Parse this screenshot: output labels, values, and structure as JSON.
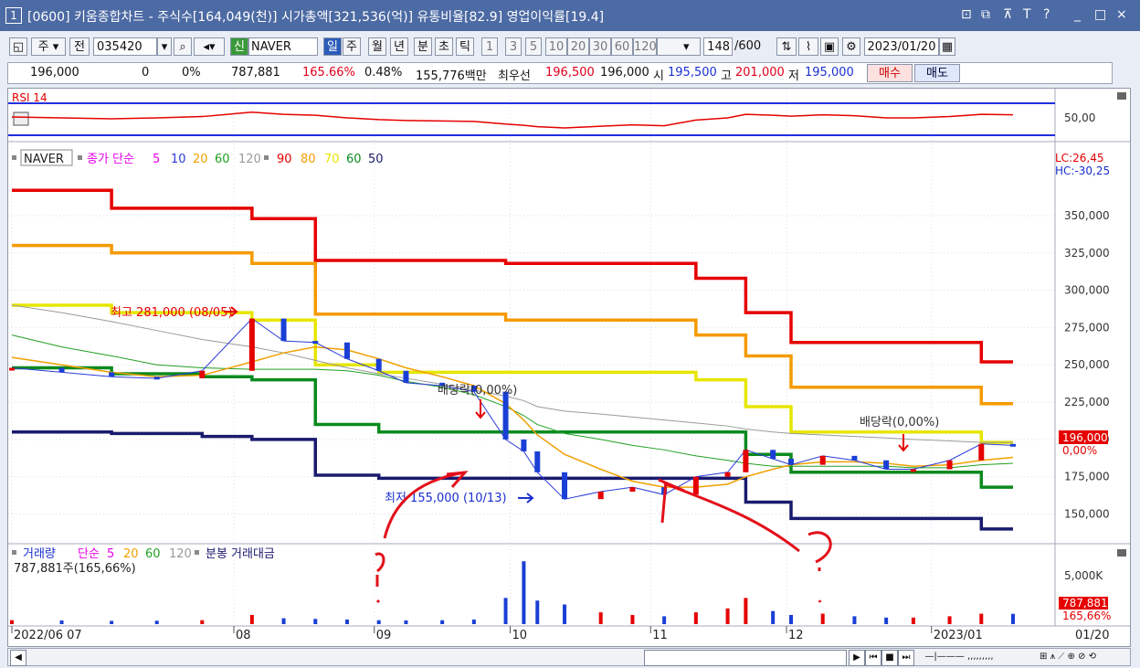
{
  "window": {
    "number": "1",
    "title": "[0600] 키움종합차트 - 주식수[164,049(천)] 시가총액[321,536(억)] 유통비율[82.9] 영업이익률[19.4]",
    "controls": [
      "⊡",
      "⧉",
      "ㄹ",
      "T",
      "?",
      "|",
      "_",
      "□",
      "×"
    ]
  },
  "toolbar": {
    "tab_week": "주",
    "tab_prev": "전",
    "code": "035420",
    "new_label": "신",
    "stock_name": "NAVER",
    "periods": [
      "일",
      "주",
      "월",
      "년",
      "분",
      "초",
      "틱"
    ],
    "minutes": [
      "1",
      "3",
      "5",
      "10",
      "20",
      "30",
      "60",
      "120"
    ],
    "count": "148",
    "count_total": "/600",
    "date": "2023/01/20"
  },
  "quote": {
    "price": "196,000",
    "change": "0",
    "change_pct": "0%",
    "volume": "787,881",
    "volume_ratio": "165.66%",
    "turnover": "0.48%",
    "amount": "155,776백만",
    "best_label": "최우선",
    "best_ask": "196,500",
    "best_bid": "196,000",
    "open_label": "시",
    "open": "195,500",
    "high_label": "고",
    "high": "201,000",
    "low_label": "저",
    "low": "195,000",
    "buy": "매수",
    "sell": "매도"
  },
  "rsi_panel": {
    "label": "RSI 14",
    "tick": "50,00"
  },
  "price_panel": {
    "legend_name": "NAVER",
    "legend_ma_label": "종가 단순",
    "ma_periods": [
      "5",
      "10",
      "20",
      "60",
      "120"
    ],
    "ma_colors": [
      "#e600e6",
      "#2b3bd6",
      "#f0a000",
      "#20a020",
      "#9a9a9a"
    ],
    "env_periods": [
      "90",
      "80",
      "70",
      "60",
      "50"
    ],
    "env_colors": [
      "#e60000",
      "#f59a00",
      "#e6e600",
      "#0a8a1e",
      "#1a1a6e"
    ],
    "lc": "LC:26,45",
    "hc": "HC:-30,25",
    "y_ticks": [
      "350,000",
      "325,000",
      "300,000",
      "275,000",
      "250,000",
      "225,000",
      "200,000",
      "175,000",
      "150,000"
    ],
    "current_price": "196,000",
    "current_pct": "0,00%",
    "annot_high": "최고 281,000 (08/05)",
    "annot_low": "최저 155,000 (10/13)",
    "annot_div1": "배당락(0,00%)",
    "annot_div2": "배당락(0,00%)"
  },
  "volume_panel": {
    "legend": "거래량",
    "legend_ma_label": "단순",
    "ma_periods": [
      "5",
      "20",
      "60",
      "120"
    ],
    "extra_label": "분봉 거래대금",
    "value_text": "787,881주(165,66%)",
    "y_tick": "5,000K",
    "current": "787,881",
    "current_pct": "165,66%"
  },
  "x_axis": {
    "labels": [
      "2022/06 07",
      "08",
      "09",
      "10",
      "11",
      "12",
      "2023/01"
    ],
    "right_label": "01/20"
  },
  "chart_data": {
    "type": "line",
    "title": "",
    "x_range": [
      "2022-06-13",
      "2023-01-20"
    ],
    "ylim": [
      135000,
      380000
    ],
    "price_series": [
      {
        "x": "2022-06-13",
        "y": 248000
      },
      {
        "x": "2022-06-24",
        "y": 245000
      },
      {
        "x": "2022-07-05",
        "y": 242000
      },
      {
        "x": "2022-07-15",
        "y": 241000
      },
      {
        "x": "2022-07-25",
        "y": 246000
      },
      {
        "x": "2022-08-05",
        "y": 281000
      },
      {
        "x": "2022-08-12",
        "y": 266000
      },
      {
        "x": "2022-08-19",
        "y": 265000
      },
      {
        "x": "2022-08-26",
        "y": 254000
      },
      {
        "x": "2022-09-02",
        "y": 246000
      },
      {
        "x": "2022-09-08",
        "y": 238000
      },
      {
        "x": "2022-09-16",
        "y": 236000
      },
      {
        "x": "2022-09-23",
        "y": 232000
      },
      {
        "x": "2022-09-30",
        "y": 200000
      },
      {
        "x": "2022-10-04",
        "y": 192000
      },
      {
        "x": "2022-10-07",
        "y": 178000
      },
      {
        "x": "2022-10-13",
        "y": 160000
      },
      {
        "x": "2022-10-21",
        "y": 165000
      },
      {
        "x": "2022-10-28",
        "y": 168000
      },
      {
        "x": "2022-11-04",
        "y": 163000
      },
      {
        "x": "2022-11-11",
        "y": 175000
      },
      {
        "x": "2022-11-18",
        "y": 178000
      },
      {
        "x": "2022-11-22",
        "y": 193000
      },
      {
        "x": "2022-11-28",
        "y": 187000
      },
      {
        "x": "2022-12-02",
        "y": 183000
      },
      {
        "x": "2022-12-09",
        "y": 189000
      },
      {
        "x": "2022-12-16",
        "y": 186000
      },
      {
        "x": "2022-12-23",
        "y": 180000
      },
      {
        "x": "2022-12-29",
        "y": 180000
      },
      {
        "x": "2023-01-06",
        "y": 186000
      },
      {
        "x": "2023-01-13",
        "y": 197000
      },
      {
        "x": "2023-01-20",
        "y": 196000
      }
    ],
    "envelope_series": [
      {
        "name": "90",
        "values": [
          367000,
          367000,
          355000,
          355000,
          355000,
          348000,
          348000,
          320000,
          320000,
          320000,
          320000,
          320000,
          320000,
          318000,
          318000,
          318000,
          318000,
          318000,
          318000,
          318000,
          308000,
          308000,
          285000,
          285000,
          265000,
          265000,
          265000,
          265000,
          265000,
          265000,
          252000,
          252000
        ]
      },
      {
        "name": "80",
        "values": [
          330000,
          330000,
          325000,
          325000,
          325000,
          318000,
          318000,
          284000,
          284000,
          284000,
          284000,
          284000,
          284000,
          280000,
          280000,
          280000,
          280000,
          280000,
          280000,
          280000,
          270000,
          270000,
          256000,
          256000,
          235000,
          235000,
          235000,
          235000,
          235000,
          235000,
          224000,
          224000
        ]
      },
      {
        "name": "70",
        "values": [
          290000,
          290000,
          285000,
          285000,
          285000,
          280000,
          280000,
          250000,
          250000,
          245000,
          245000,
          245000,
          245000,
          245000,
          245000,
          245000,
          245000,
          245000,
          245000,
          245000,
          240000,
          240000,
          222000,
          222000,
          205000,
          205000,
          205000,
          205000,
          205000,
          205000,
          198000,
          198000
        ]
      },
      {
        "name": "60",
        "values": [
          248000,
          248000,
          244000,
          244000,
          242000,
          240000,
          240000,
          210000,
          210000,
          205000,
          205000,
          205000,
          205000,
          205000,
          205000,
          205000,
          205000,
          205000,
          205000,
          205000,
          205000,
          205000,
          190000,
          190000,
          178000,
          178000,
          178000,
          178000,
          178000,
          178000,
          168000,
          168000
        ]
      },
      {
        "name": "50",
        "values": [
          205000,
          205000,
          204000,
          204000,
          202000,
          200000,
          200000,
          176000,
          176000,
          174000,
          174000,
          174000,
          174000,
          174000,
          174000,
          174000,
          174000,
          174000,
          174000,
          174000,
          174000,
          174000,
          158000,
          158000,
          147000,
          147000,
          147000,
          147000,
          147000,
          147000,
          140000,
          140000
        ]
      }
    ],
    "ma120": [
      290000,
      285000,
      279000,
      273000,
      267000,
      262000,
      258000,
      253000,
      248000,
      244000,
      241000,
      237000,
      233000,
      229000,
      226000,
      222000,
      219000,
      217000,
      215000,
      213000,
      211000,
      209000,
      207000,
      205000,
      204000,
      203000,
      202000,
      201000,
      200000,
      199000,
      198000,
      198000
    ],
    "ma60": [
      270000,
      262000,
      256000,
      250000,
      248000,
      247000,
      247000,
      247000,
      246000,
      243000,
      239000,
      235000,
      230000,
      222000,
      216000,
      210000,
      204000,
      200000,
      196000,
      193000,
      189000,
      186000,
      184000,
      182000,
      182000,
      182000,
      182000,
      182000,
      181000,
      181000,
      183000,
      184000
    ],
    "ma20": [
      255000,
      250000,
      245000,
      242000,
      243000,
      252000,
      258000,
      262000,
      260000,
      254000,
      248000,
      242000,
      236000,
      224000,
      213000,
      203000,
      190000,
      180000,
      172000,
      168000,
      168000,
      170000,
      175000,
      180000,
      183000,
      185000,
      185000,
      184000,
      182000,
      183000,
      186000,
      188000
    ],
    "rsi14": [
      52,
      50,
      48,
      50,
      53,
      63,
      58,
      56,
      50,
      46,
      44,
      43,
      42,
      36,
      33,
      30,
      27,
      31,
      34,
      32,
      45,
      50,
      58,
      56,
      54,
      57,
      55,
      50,
      50,
      53,
      58,
      57
    ],
    "volume_k": [
      300,
      280,
      250,
      260,
      300,
      700,
      450,
      400,
      350,
      300,
      280,
      300,
      350,
      2000,
      4800,
      1800,
      1500,
      900,
      700,
      600,
      900,
      1200,
      2000,
      1000,
      700,
      800,
      600,
      500,
      500,
      600,
      800,
      788
    ]
  }
}
